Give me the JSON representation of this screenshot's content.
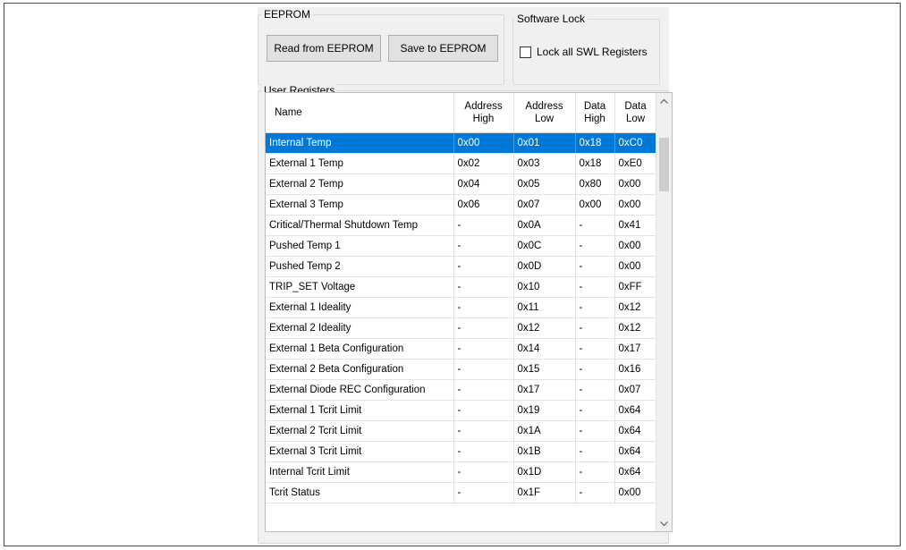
{
  "eeprom": {
    "legend": "EEPROM",
    "read_label": "Read from EEPROM",
    "save_label": "Save to EEPROM"
  },
  "software_lock": {
    "legend": "Software Lock",
    "checkbox_label": "Lock all SWL Registers",
    "checked": false
  },
  "user_registers": {
    "legend": "User Registers",
    "columns": {
      "name": "Name",
      "addr_high": [
        "Address",
        "High"
      ],
      "addr_low": [
        "Address",
        "Low"
      ],
      "data_high": [
        "Data",
        "High"
      ],
      "data_low": [
        "Data",
        "Low"
      ]
    },
    "rows": [
      {
        "name": "Internal Temp",
        "addr_high": "0x00",
        "addr_low": "0x01",
        "data_high": "0x18",
        "data_low": "0xC0",
        "selected": true
      },
      {
        "name": "External 1 Temp",
        "addr_high": "0x02",
        "addr_low": "0x03",
        "data_high": "0x18",
        "data_low": "0xE0"
      },
      {
        "name": "External 2 Temp",
        "addr_high": "0x04",
        "addr_low": "0x05",
        "data_high": "0x80",
        "data_low": "0x00"
      },
      {
        "name": "External 3 Temp",
        "addr_high": "0x06",
        "addr_low": "0x07",
        "data_high": "0x00",
        "data_low": "0x00"
      },
      {
        "name": "Critical/Thermal Shutdown Temp",
        "addr_high": "-",
        "addr_low": "0x0A",
        "data_high": "-",
        "data_low": "0x41"
      },
      {
        "name": "Pushed Temp 1",
        "addr_high": "-",
        "addr_low": "0x0C",
        "data_high": "-",
        "data_low": "0x00"
      },
      {
        "name": "Pushed Temp 2",
        "addr_high": "-",
        "addr_low": "0x0D",
        "data_high": "-",
        "data_low": "0x00"
      },
      {
        "name": "TRIP_SET Voltage",
        "addr_high": "-",
        "addr_low": "0x10",
        "data_high": "-",
        "data_low": "0xFF"
      },
      {
        "name": "External 1 Ideality",
        "addr_high": "-",
        "addr_low": "0x11",
        "data_high": "-",
        "data_low": "0x12"
      },
      {
        "name": "External 2 Ideality",
        "addr_high": "-",
        "addr_low": "0x12",
        "data_high": "-",
        "data_low": "0x12"
      },
      {
        "name": "External 1 Beta Configuration",
        "addr_high": "-",
        "addr_low": "0x14",
        "data_high": "-",
        "data_low": "0x17"
      },
      {
        "name": "External 2 Beta Configuration",
        "addr_high": "-",
        "addr_low": "0x15",
        "data_high": "-",
        "data_low": "0x16"
      },
      {
        "name": "External Diode REC Configuration",
        "addr_high": "-",
        "addr_low": "0x17",
        "data_high": "-",
        "data_low": "0x07"
      },
      {
        "name": "External 1 Tcrit Limit",
        "addr_high": "-",
        "addr_low": "0x19",
        "data_high": "-",
        "data_low": "0x64"
      },
      {
        "name": "External 2 Tcrit Limit",
        "addr_high": "-",
        "addr_low": "0x1A",
        "data_high": "-",
        "data_low": "0x64"
      },
      {
        "name": "External 3 Tcrit Limit",
        "addr_high": "-",
        "addr_low": "0x1B",
        "data_high": "-",
        "data_low": "0x64"
      },
      {
        "name": "Internal Tcrit Limit",
        "addr_high": "-",
        "addr_low": "0x1D",
        "data_high": "-",
        "data_low": "0x64"
      },
      {
        "name": "Tcrit Status",
        "addr_high": "-",
        "addr_low": "0x1F",
        "data_high": "-",
        "data_low": "0x00"
      }
    ]
  },
  "icons": {
    "scroll_up": "chevron-up-icon",
    "scroll_down": "chevron-down-icon"
  },
  "colors": {
    "selection": "#0078d7",
    "panel": "#f0f0f0"
  }
}
